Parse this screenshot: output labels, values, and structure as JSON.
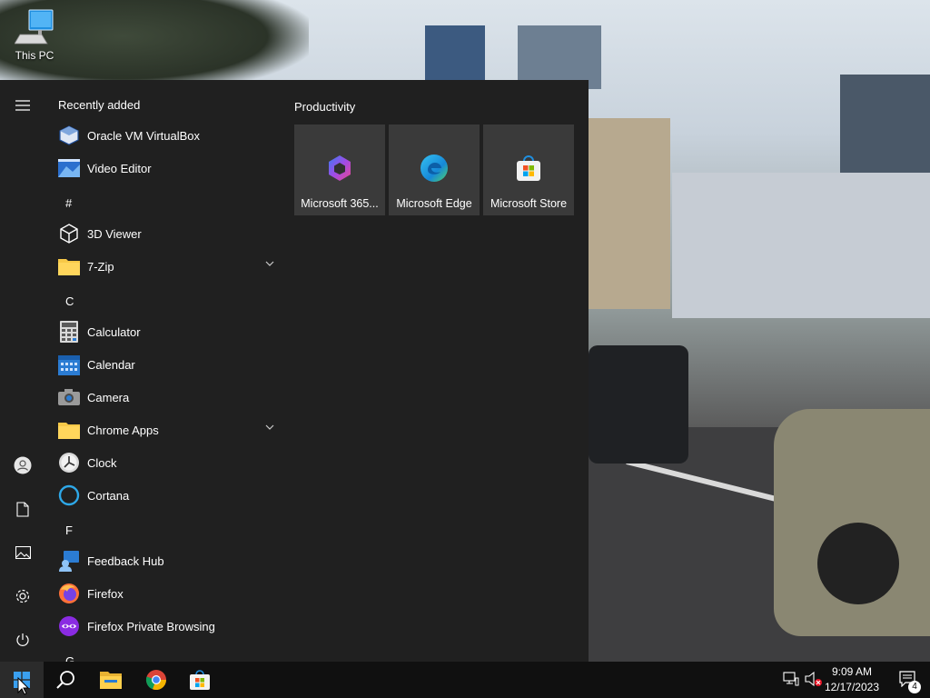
{
  "desktop": {
    "icons": [
      {
        "label": "This PC",
        "icon": "this-pc-icon"
      }
    ]
  },
  "start_menu": {
    "recently_added_heading": "Recently added",
    "recently_added": [
      {
        "label": "Oracle VM VirtualBox",
        "icon": "virtualbox-icon"
      },
      {
        "label": "Video Editor",
        "icon": "video-editor-icon"
      }
    ],
    "groups": [
      {
        "letter": "#",
        "apps": [
          {
            "label": "3D Viewer",
            "icon": "3d-viewer-icon"
          },
          {
            "label": "7-Zip",
            "icon": "folder-icon",
            "expandable": true
          }
        ]
      },
      {
        "letter": "C",
        "apps": [
          {
            "label": "Calculator",
            "icon": "calculator-icon"
          },
          {
            "label": "Calendar",
            "icon": "calendar-icon"
          },
          {
            "label": "Camera",
            "icon": "camera-icon"
          },
          {
            "label": "Chrome Apps",
            "icon": "folder-icon",
            "expandable": true
          },
          {
            "label": "Clock",
            "icon": "clock-icon"
          },
          {
            "label": "Cortana",
            "icon": "cortana-icon"
          }
        ]
      },
      {
        "letter": "F",
        "apps": [
          {
            "label": "Feedback Hub",
            "icon": "feedback-hub-icon"
          },
          {
            "label": "Firefox",
            "icon": "firefox-icon"
          },
          {
            "label": "Firefox Private Browsing",
            "icon": "firefox-private-icon"
          }
        ]
      },
      {
        "letter": "G",
        "apps": []
      }
    ],
    "tiles_heading": "Productivity",
    "tiles": [
      {
        "label": "Microsoft 365...",
        "icon": "microsoft-365-icon"
      },
      {
        "label": "Microsoft Edge",
        "icon": "edge-icon"
      },
      {
        "label": "Microsoft Store",
        "icon": "store-icon"
      }
    ]
  },
  "taskbar": {
    "time": "9:09 AM",
    "date": "12/17/2023",
    "notification_count": "4"
  },
  "colors": {
    "start_bg": "#202020",
    "tile_bg": "#3a3a3a",
    "taskbar_bg": "#101010",
    "accent": "#0078d7"
  }
}
